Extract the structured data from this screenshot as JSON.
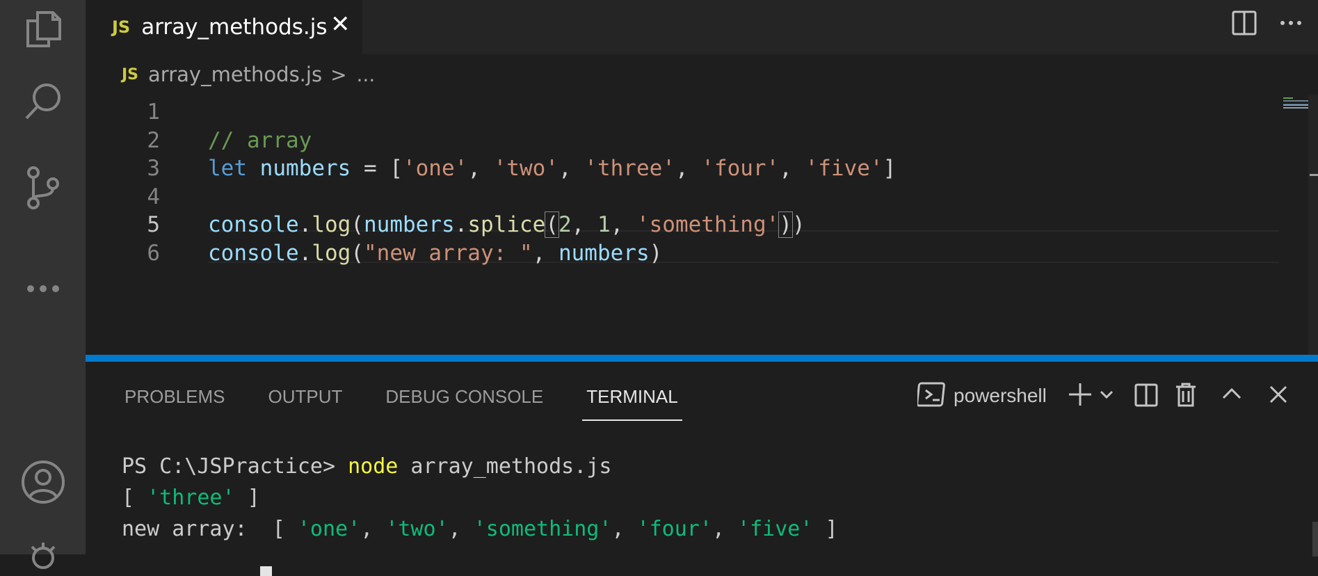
{
  "window": {
    "accent_color": "#007acc",
    "background": "#1e1e1e"
  },
  "activity_bar": {
    "items": [
      "files-icon",
      "search-icon",
      "source-control-icon",
      "more-icon",
      "account-icon",
      "settings-icon"
    ]
  },
  "tab": {
    "badge": "JS",
    "title": "array_methods.js",
    "close": "✕"
  },
  "breadcrumb": {
    "badge": "JS",
    "file": "array_methods.js",
    "separator": ">",
    "more": "..."
  },
  "editor": {
    "active_line": 5,
    "lines": [
      {
        "number": "1",
        "tokens": []
      },
      {
        "number": "2",
        "tokens": [
          {
            "t": "// array",
            "c": "comment"
          }
        ]
      },
      {
        "number": "3",
        "tokens": [
          {
            "t": "let",
            "c": "kw"
          },
          {
            "t": " ",
            "c": "p"
          },
          {
            "t": "numbers",
            "c": "var"
          },
          {
            "t": " = [",
            "c": "p"
          },
          {
            "t": "'one'",
            "c": "str"
          },
          {
            "t": ", ",
            "c": "p"
          },
          {
            "t": "'two'",
            "c": "str"
          },
          {
            "t": ", ",
            "c": "p"
          },
          {
            "t": "'three'",
            "c": "str"
          },
          {
            "t": ", ",
            "c": "p"
          },
          {
            "t": "'four'",
            "c": "str"
          },
          {
            "t": ", ",
            "c": "p"
          },
          {
            "t": "'five'",
            "c": "str"
          },
          {
            "t": "]",
            "c": "p"
          }
        ]
      },
      {
        "number": "4",
        "tokens": []
      },
      {
        "number": "5",
        "tokens": [
          {
            "t": "console",
            "c": "var"
          },
          {
            "t": ".",
            "c": "p"
          },
          {
            "t": "log",
            "c": "fn"
          },
          {
            "t": "(",
            "c": "p"
          },
          {
            "t": "numbers",
            "c": "var"
          },
          {
            "t": ".",
            "c": "p"
          },
          {
            "t": "splice",
            "c": "fn"
          },
          {
            "t": "(",
            "c": "p",
            "m": 1
          },
          {
            "t": "2",
            "c": "num"
          },
          {
            "t": ", ",
            "c": "p"
          },
          {
            "t": "1",
            "c": "num"
          },
          {
            "t": ", ",
            "c": "p"
          },
          {
            "t": "'something'",
            "c": "str"
          },
          {
            "t": ")",
            "c": "p",
            "m": 1
          },
          {
            "t": ")",
            "c": "p"
          }
        ]
      },
      {
        "number": "6",
        "tokens": [
          {
            "t": "console",
            "c": "var"
          },
          {
            "t": ".",
            "c": "p"
          },
          {
            "t": "log",
            "c": "fn"
          },
          {
            "t": "(",
            "c": "p"
          },
          {
            "t": "\"new array: \"",
            "c": "str"
          },
          {
            "t": ", ",
            "c": "p"
          },
          {
            "t": "numbers",
            "c": "var"
          },
          {
            "t": ")",
            "c": "p"
          }
        ]
      }
    ]
  },
  "panel": {
    "tabs": [
      "PROBLEMS",
      "OUTPUT",
      "DEBUG CONSOLE",
      "TERMINAL"
    ],
    "active_tab": "TERMINAL",
    "shell": "powershell"
  },
  "terminal": {
    "lines": [
      [
        {
          "t": "PS C:\\JSPractice> ",
          "c": "plain"
        },
        {
          "t": "node",
          "c": "yellow"
        },
        {
          "t": " array_methods.js",
          "c": "plain"
        }
      ],
      [
        {
          "t": "[ ",
          "c": "plain"
        },
        {
          "t": "'three'",
          "c": "green"
        },
        {
          "t": " ]",
          "c": "plain"
        }
      ],
      [
        {
          "t": "new array:  [ ",
          "c": "plain"
        },
        {
          "t": "'one'",
          "c": "green"
        },
        {
          "t": ", ",
          "c": "plain"
        },
        {
          "t": "'two'",
          "c": "green"
        },
        {
          "t": ", ",
          "c": "plain"
        },
        {
          "t": "'something'",
          "c": "green"
        },
        {
          "t": ", ",
          "c": "plain"
        },
        {
          "t": "'four'",
          "c": "green"
        },
        {
          "t": ", ",
          "c": "plain"
        },
        {
          "t": "'five'",
          "c": "green"
        },
        {
          "t": " ]",
          "c": "plain"
        }
      ]
    ]
  }
}
